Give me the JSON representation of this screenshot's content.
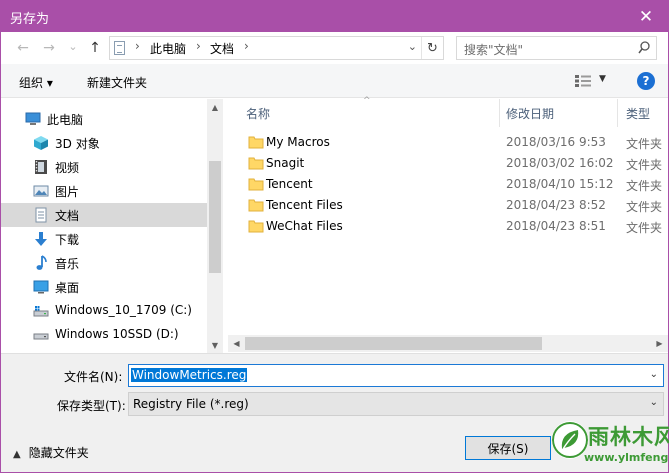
{
  "window": {
    "title": "另存为",
    "close_glyph": "✕",
    "accent": "#a94fa8"
  },
  "nav": {
    "back_glyph": "←",
    "forward_glyph": "→",
    "recent_glyph": "⌄",
    "up_glyph": "↑",
    "breadcrumbs": [
      "此电脑",
      "文档"
    ],
    "crumb_sep": "›",
    "address_dropdown_glyph": "⌄",
    "refresh_glyph": "↻",
    "search_placeholder": "搜索\"文档\""
  },
  "toolbar": {
    "organize_label": "组织 ▾",
    "new_folder_label": "新建文件夹",
    "view_dropdown_glyph": "▼",
    "help_label": "?"
  },
  "sidebar": {
    "items": [
      {
        "label": "此电脑",
        "icon": "computer-icon"
      },
      {
        "label": "3D 对象",
        "icon": "cube-3d-icon"
      },
      {
        "label": "视频",
        "icon": "video-icon"
      },
      {
        "label": "图片",
        "icon": "picture-icon"
      },
      {
        "label": "文档",
        "icon": "document-icon",
        "selected": true
      },
      {
        "label": "下载",
        "icon": "download-icon"
      },
      {
        "label": "音乐",
        "icon": "music-icon"
      },
      {
        "label": "桌面",
        "icon": "desktop-icon"
      },
      {
        "label": "Windows_10_1709 (C:)",
        "icon": "drive-icon"
      },
      {
        "label": "Windows 10SSD (D:)",
        "icon": "drive-icon"
      }
    ],
    "scroll_up_glyph": "▲",
    "scroll_down_glyph": "▼"
  },
  "files": {
    "columns": {
      "name": "名称",
      "modified": "修改日期",
      "type": "类型"
    },
    "sort_glyph": "^",
    "rows": [
      {
        "name": "My Macros",
        "date": "2018/03/16 9:53",
        "type": "文件夹"
      },
      {
        "name": "Snagit",
        "date": "2018/03/02 16:02",
        "type": "文件夹"
      },
      {
        "name": "Tencent",
        "date": "2018/04/10 15:12",
        "type": "文件夹"
      },
      {
        "name": "Tencent Files",
        "date": "2018/04/23 8:52",
        "type": "文件夹"
      },
      {
        "name": "WeChat Files",
        "date": "2018/04/23 8:51",
        "type": "文件夹"
      }
    ],
    "scroll_left_glyph": "◀",
    "scroll_right_glyph": "▶"
  },
  "form": {
    "filename_label": "文件名(N):",
    "filename_value": "WindowMetrics.reg",
    "filetype_label": "保存类型(T):",
    "filetype_value": "Registry File (*.reg)",
    "dropdown_glyph": "⌄",
    "hide_folders_label": "隐藏文件夹",
    "hide_folders_glyph": "▲",
    "save_label": "保存(S)"
  },
  "watermark": {
    "brand": "雨林木风",
    "url": "www.ylmfeng.com"
  }
}
